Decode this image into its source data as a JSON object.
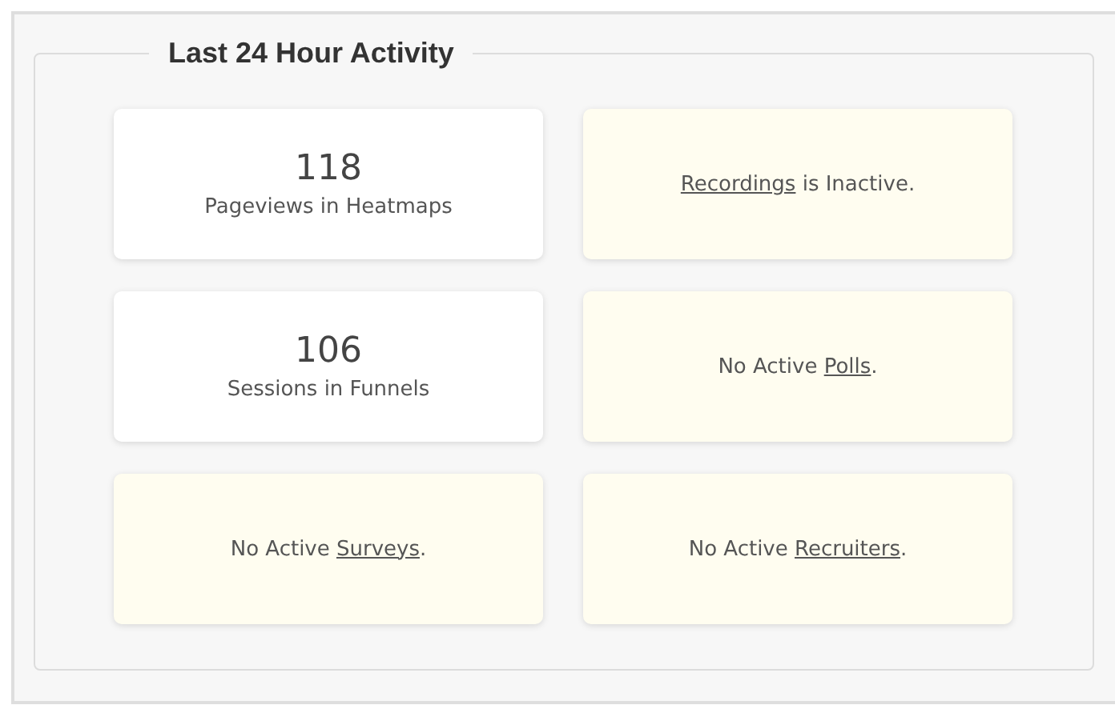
{
  "section": {
    "title": "Last 24 Hour Activity"
  },
  "cards": [
    {
      "kind": "stat",
      "value": "118",
      "label": "Pageviews in Heatmaps"
    },
    {
      "kind": "notice",
      "link": "Recordings",
      "after": " is Inactive."
    },
    {
      "kind": "stat",
      "value": "106",
      "label": "Sessions in Funnels"
    },
    {
      "kind": "notice",
      "before": "No Active ",
      "link": "Polls",
      "after": "."
    },
    {
      "kind": "notice",
      "before": "No Active ",
      "link": "Surveys",
      "after": "."
    },
    {
      "kind": "notice",
      "before": "No Active ",
      "link": "Recruiters",
      "after": "."
    }
  ]
}
